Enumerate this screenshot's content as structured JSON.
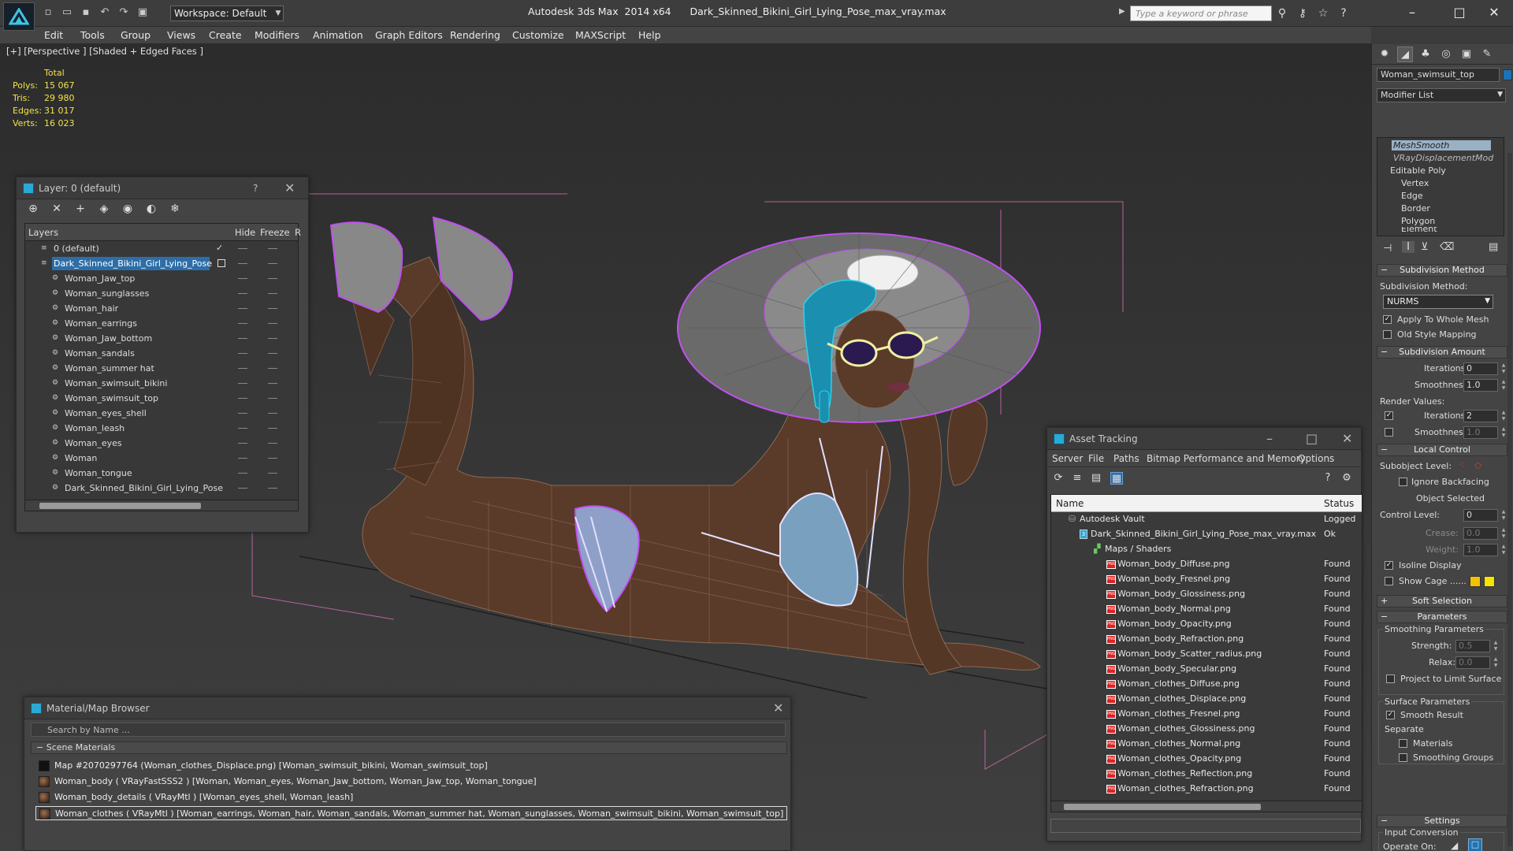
{
  "titlebar": {
    "workspace": "Workspace: Default",
    "app_title": "Autodesk 3ds Max  2014 x64      Dark_Skinned_Bikini_Girl_Lying_Pose_max_vray.max",
    "search_placeholder": "Type a keyword or phrase"
  },
  "menu": [
    "Edit",
    "Tools",
    "Group",
    "Views",
    "Create",
    "Modifiers",
    "Animation",
    "Graph Editors",
    "Rendering",
    "Customize",
    "MAXScript",
    "Help"
  ],
  "viewport": {
    "label": "[+] [Perspective ] [Shaded + Edged Faces ]",
    "stats": {
      "header": "Total",
      "rows": [
        {
          "k": "Polys:",
          "v": "15 067"
        },
        {
          "k": "Tris:",
          "v": "29 980"
        },
        {
          "k": "Edges:",
          "v": "31 017"
        },
        {
          "k": "Verts:",
          "v": "16 023"
        }
      ]
    }
  },
  "layer_window": {
    "title": "Layer: 0 (default)",
    "help": "?",
    "col_layers": "Layers",
    "col_hide": "Hide",
    "col_freeze": "Freeze",
    "col_r": "R",
    "rows": [
      {
        "name": "0 (default)",
        "level": 1
      },
      {
        "name": "Dark_Skinned_Bikini_Girl_Lying_Pose",
        "level": 1
      },
      {
        "name": "Woman_Jaw_top",
        "level": 2
      },
      {
        "name": "Woman_sunglasses",
        "level": 2
      },
      {
        "name": "Woman_hair",
        "level": 2
      },
      {
        "name": "Woman_earrings",
        "level": 2
      },
      {
        "name": "Woman_Jaw_bottom",
        "level": 2
      },
      {
        "name": "Woman_sandals",
        "level": 2
      },
      {
        "name": "Woman_summer hat",
        "level": 2
      },
      {
        "name": "Woman_swimsuit_bikini",
        "level": 2
      },
      {
        "name": "Woman_swimsuit_top",
        "level": 2
      },
      {
        "name": "Woman_eyes_shell",
        "level": 2
      },
      {
        "name": "Woman_leash",
        "level": 2
      },
      {
        "name": "Woman_eyes",
        "level": 2
      },
      {
        "name": "Woman",
        "level": 2
      },
      {
        "name": "Woman_tongue",
        "level": 2
      },
      {
        "name": "Dark_Skinned_Bikini_Girl_Lying_Pose",
        "level": 2
      }
    ]
  },
  "material_browser": {
    "title": "Material/Map Browser",
    "search": "Search by Name ...",
    "section": "Scene Materials",
    "rows": [
      "Map #2070297764 (Woman_clothes_Displace.png) [Woman_swimsuit_bikini, Woman_swimsuit_top]",
      "Woman_body  ( VRayFastSSS2 ) [Woman, Woman_eyes, Woman_Jaw_bottom, Woman_Jaw_top, Woman_tongue]",
      "Woman_body_details  ( VRayMtl ) [Woman_eyes_shell, Woman_leash]",
      "Woman_clothes  ( VRayMtl ) [Woman_earrings, Woman_hair, Woman_sandals, Woman_summer hat, Woman_sunglasses, Woman_swimsuit_bikini, Woman_swimsuit_top]"
    ]
  },
  "asset_tracking": {
    "title": "Asset Tracking",
    "menu": [
      "Server",
      "File",
      "Paths",
      "Bitmap Performance and Memory",
      "Options"
    ],
    "col_name": "Name",
    "col_status": "Status",
    "rows": [
      {
        "name": "Autodesk Vault",
        "status": "Logged",
        "indent": 1
      },
      {
        "name": "Dark_Skinned_Bikini_Girl_Lying_Pose_max_vray.max",
        "status": "Ok",
        "indent": 2
      },
      {
        "name": "Maps / Shaders",
        "status": "",
        "indent": 3
      },
      {
        "name": "Woman_body_Diffuse.png",
        "status": "Found",
        "indent": 4
      },
      {
        "name": "Woman_body_Fresnel.png",
        "status": "Found",
        "indent": 4
      },
      {
        "name": "Woman_body_Glossiness.png",
        "status": "Found",
        "indent": 4
      },
      {
        "name": "Woman_body_Normal.png",
        "status": "Found",
        "indent": 4
      },
      {
        "name": "Woman_body_Opacity.png",
        "status": "Found",
        "indent": 4
      },
      {
        "name": "Woman_body_Refraction.png",
        "status": "Found",
        "indent": 4
      },
      {
        "name": "Woman_body_Scatter_radius.png",
        "status": "Found",
        "indent": 4
      },
      {
        "name": "Woman_body_Specular.png",
        "status": "Found",
        "indent": 4
      },
      {
        "name": "Woman_clothes_Diffuse.png",
        "status": "Found",
        "indent": 4
      },
      {
        "name": "Woman_clothes_Displace.png",
        "status": "Found",
        "indent": 4
      },
      {
        "name": "Woman_clothes_Fresnel.png",
        "status": "Found",
        "indent": 4
      },
      {
        "name": "Woman_clothes_Glossiness.png",
        "status": "Found",
        "indent": 4
      },
      {
        "name": "Woman_clothes_Normal.png",
        "status": "Found",
        "indent": 4
      },
      {
        "name": "Woman_clothes_Opacity.png",
        "status": "Found",
        "indent": 4
      },
      {
        "name": "Woman_clothes_Reflection.png",
        "status": "Found",
        "indent": 4
      },
      {
        "name": "Woman_clothes_Refraction.png",
        "status": "Found",
        "indent": 4
      }
    ]
  },
  "command_panel": {
    "object_name": "Woman_swimsuit_top",
    "modifier_list": "Modifier List",
    "stack": [
      "MeshSmooth",
      "VRayDisplacementMod",
      "Editable Poly",
      "Vertex",
      "Edge",
      "Border",
      "Polygon",
      "Element"
    ],
    "subdivision_method": {
      "rollout": "Subdivision Method",
      "label": "Subdivision Method:",
      "value": "NURMS",
      "apply_whole": "Apply To Whole Mesh",
      "old_style": "Old Style Mapping"
    },
    "subdivision_amount": {
      "rollout": "Subdivision Amount",
      "iterations_label": "Iterations:",
      "iterations": "0",
      "smoothness_label": "Smoothness:",
      "smoothness": "1.0",
      "render_values": "Render Values:",
      "r_iterations_label": "Iterations:",
      "r_iterations": "2",
      "r_smoothness_label": "Smoothness:",
      "r_smoothness": "1.0"
    },
    "local_control": {
      "rollout": "Local Control",
      "subobject_level": "Subobject Level:",
      "ignore_backfacing": "Ignore Backfacing",
      "object_selected": "Object Selected",
      "control_level_label": "Control Level:",
      "control_level": "0",
      "crease_label": "Crease:",
      "crease": "0.0",
      "weight_label": "Weight:",
      "weight": "1.0",
      "isoline": "Isoline Display",
      "show_cage": "Show Cage ......",
      "cage_color_1": "#f2c200",
      "cage_color_2": "#f5e400"
    },
    "soft_selection": "Soft Selection",
    "parameters": {
      "rollout": "Parameters",
      "smoothing_params": "Smoothing Parameters",
      "strength_label": "Strength:",
      "strength": "0.5",
      "relax_label": "Relax:",
      "relax": "0.0",
      "project": "Project to Limit Surface",
      "surface_params": "Surface Parameters",
      "smooth_result": "Smooth Result",
      "separate": "Separate",
      "materials": "Materials",
      "smoothing_groups": "Smoothing Groups"
    },
    "settings": {
      "rollout": "Settings",
      "input_conversion": "Input Conversion",
      "operate_on": "Operate On:"
    }
  },
  "colors": {
    "accent": "#2d6ea8",
    "wire_purple": "#c050f0",
    "hat_cyan": "#30d0e8",
    "skin": "#5a3a28",
    "stats_yellow": "#f2e24a"
  }
}
